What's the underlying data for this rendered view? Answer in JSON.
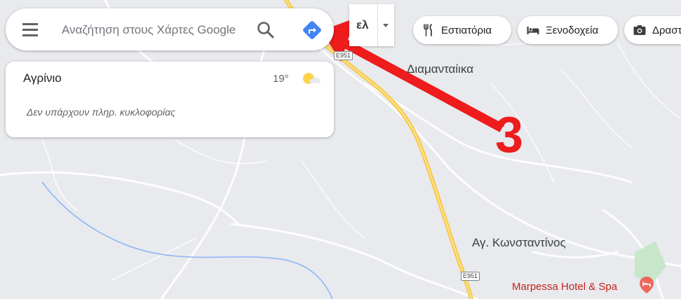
{
  "search": {
    "placeholder": "Αναζήτηση στους Χάρτες Google",
    "menu_icon": "hamburger-menu-icon",
    "search_icon": "magnifier-icon",
    "directions_icon": "directions-diamond-icon",
    "directions_color": "#4285f4"
  },
  "weather": {
    "city": "Αγρίνιο",
    "temperature": "19°",
    "icon": "sun-cloud-icon",
    "traffic_message": "Δεν υπάρχουν πληρ. κυκλοφορίας"
  },
  "layers": {
    "language_label": "ελ",
    "dropdown_icon": "caret-down-icon"
  },
  "categories": [
    {
      "label": "Εστιατόρια",
      "icon": "fork-knife-icon"
    },
    {
      "label": "Ξενοδοχεία",
      "icon": "bed-icon"
    },
    {
      "label": "Δραστηριότητες",
      "icon": "camera-icon"
    }
  ],
  "map": {
    "place_labels": [
      "Διαμανταίικα",
      "Αγ. Κωνσταντίνος"
    ],
    "poi": {
      "label": "Marpessa Hotel & Spa",
      "icon": "hotel-pin-icon",
      "color": "#c5221f"
    },
    "road_shields": [
      "E951",
      "E951"
    ],
    "road_color": "#f7c948"
  },
  "annotation": {
    "number": "3",
    "color": "#ee1c1c"
  }
}
